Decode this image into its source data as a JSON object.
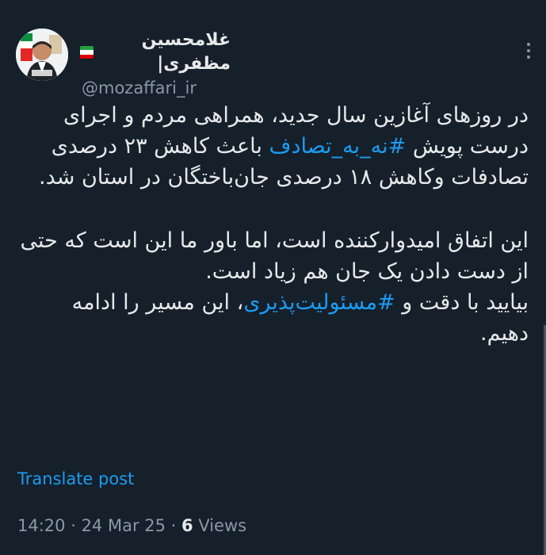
{
  "profile": {
    "display_name": "غلامحسین مظفری|",
    "handle": "@mozaffari_ir",
    "flag_colors": [
      "#239f40",
      "#ffffff",
      "#da0000"
    ]
  },
  "tweet": {
    "paragraph_1": {
      "line_1": "در روزهای آغازین سال جدید، همراهی مردم و اجرای",
      "line_2_prefix": "درست پویش ",
      "hashtag_1": "#نه_به_تصادف",
      "line_2_suffix": " باعث کاهش ۲۳",
      "line_3": "درصدی تصادفات وکاهش ۱۸ درصدی جان‌باختگان در",
      "line_4": "استان شد."
    },
    "paragraph_2": {
      "line_1": "این اتفاق امیدوارکننده است، اما باور ما این است که",
      "line_2": "حتی از دست دادن یک جان هم زیاد است.",
      "line_3_prefix": "بیایید با دقت و ",
      "hashtag_2": "#مسئولیت‌پذیری",
      "line_3_suffix": "، این مسیر را ادامه",
      "line_4": "دهیم."
    }
  },
  "translate_label": "Translate post",
  "meta": {
    "time": "14:20",
    "separator": " · ",
    "date": "24 Mar 25",
    "views_count": "6",
    "views_label": " Views"
  },
  "icons": {
    "more": "more-vertical-icon"
  },
  "colors": {
    "background": "#15202b",
    "text": "#e7e9ea",
    "secondary": "#8b98a5",
    "accent": "#1d9bf0"
  }
}
